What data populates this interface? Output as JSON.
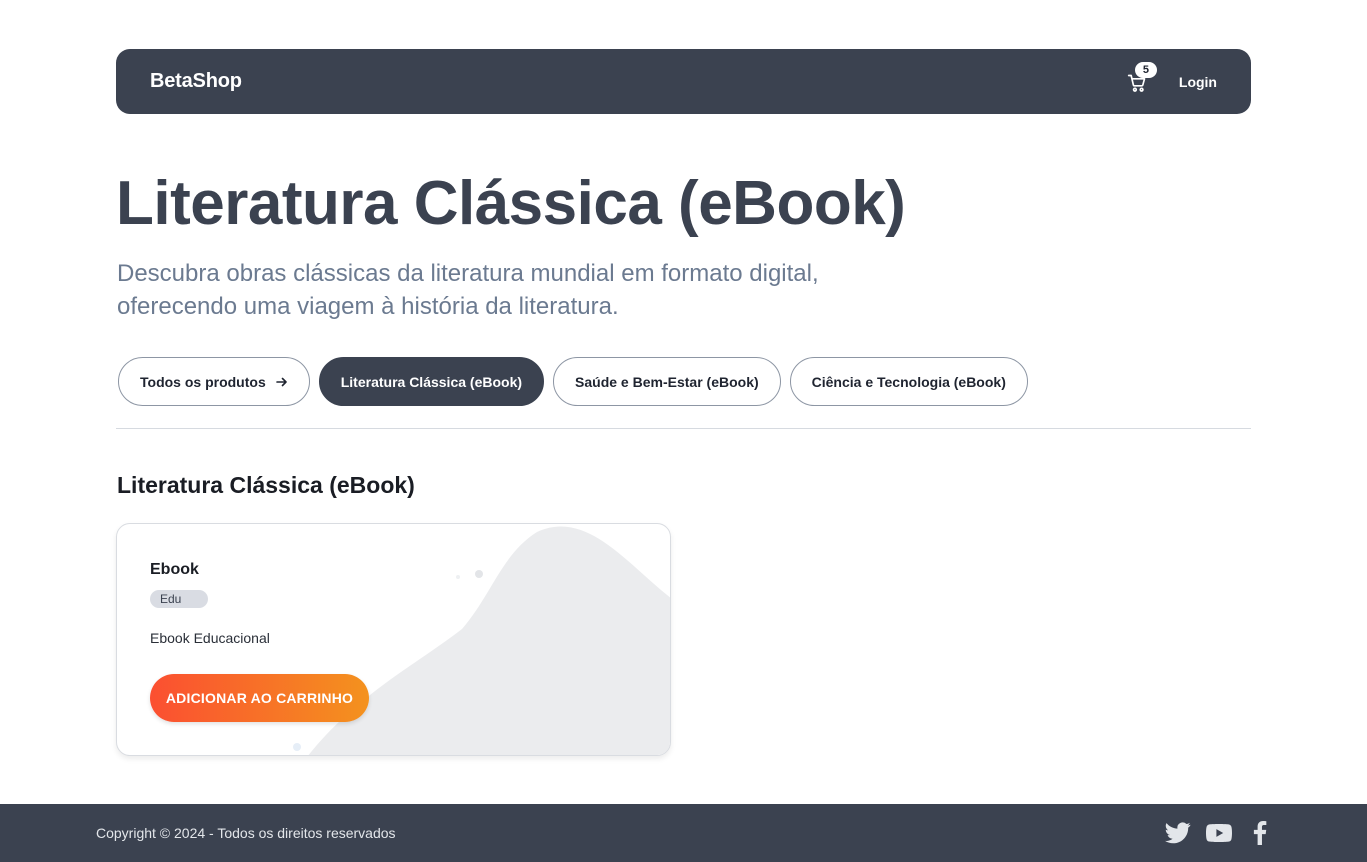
{
  "navbar": {
    "brand": "BetaShop",
    "cart_count": "5",
    "login_label": "Login",
    "cart_icon": "cart-icon"
  },
  "hero": {
    "title": "Literatura Clássica (eBook)",
    "description": "Descubra obras clássicas da literatura mundial em formato digital, oferecendo uma viagem à história da literatura."
  },
  "filters": [
    {
      "label": "Todos os produtos",
      "icon": "arrow-right-icon",
      "active": false
    },
    {
      "label": "Literatura Clássica (eBook)",
      "active": true
    },
    {
      "label": "Saúde e Bem-Estar (eBook)",
      "active": false
    },
    {
      "label": "Ciência e Tecnologia (eBook)",
      "active": false
    }
  ],
  "section": {
    "title": "Literatura Clássica (eBook)"
  },
  "products": [
    {
      "name": "Ebook",
      "tag": "Edu",
      "description": "Ebook Educacional",
      "button_label": "ADICIONAR AO CARRINHO"
    }
  ],
  "footer": {
    "copyright": "Copyright © 2024 - Todos os direitos reservados",
    "socials": [
      "twitter-icon",
      "youtube-icon",
      "facebook-icon"
    ]
  },
  "colors": {
    "navbar_bg": "#3b4250",
    "button_gradient_start": "#fb4f31",
    "button_gradient_end": "#f4921e",
    "title": "#3b4250",
    "description": "#6b7a90"
  }
}
